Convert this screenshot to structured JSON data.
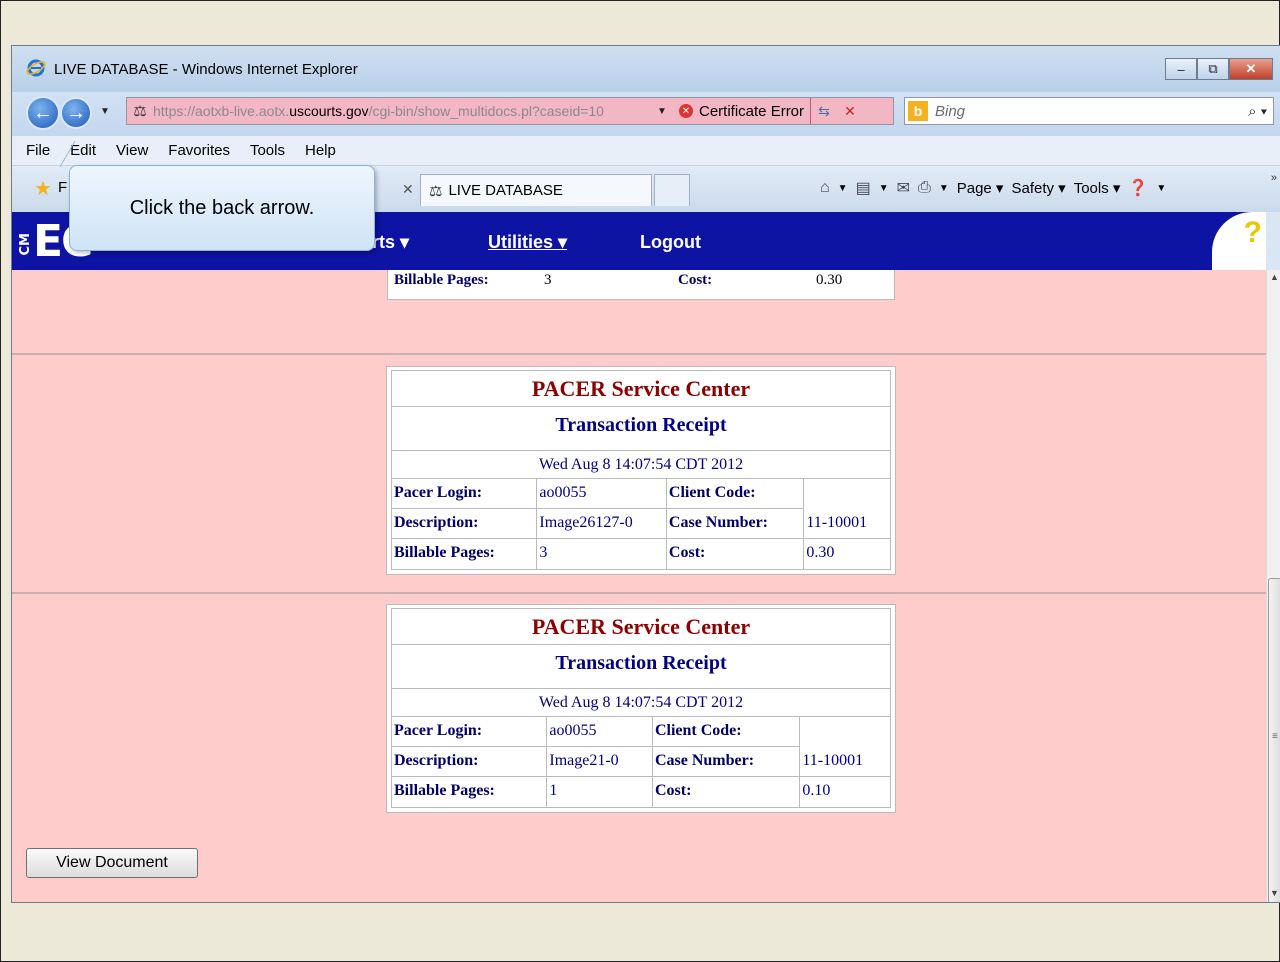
{
  "window": {
    "title": "LIVE DATABASE - Windows Internet Explorer",
    "minimize": "‒",
    "restore": "⧉",
    "close": "✕"
  },
  "address": {
    "url_prefix": "https://aotxb-live.aotx.",
    "url_domain": "uscourts.gov",
    "url_path": "/cgi-bin/show_multidocs.pl?caseid=10",
    "cert_error": "Certificate Error"
  },
  "search": {
    "placeholder": "Bing"
  },
  "menu": [
    "File",
    "Edit",
    "View",
    "Favorites",
    "Tools",
    "Help"
  ],
  "favorites": {
    "letter": "F",
    "tab_title": "LIVE DATABASE",
    "commands": [
      "Page ▾",
      "Safety ▾",
      "Tools ▾"
    ]
  },
  "tooltip": {
    "text": "Click the back arrow."
  },
  "cmecf": {
    "logo_small": "CM",
    "logo": "EC",
    "nav": [
      "rts ▾",
      "Utilities ▾",
      "Logout"
    ],
    "help": "?"
  },
  "partial_receipt": {
    "label1": "Billable Pages:",
    "value1": "3",
    "label2": "Cost:",
    "value2": "0.30"
  },
  "receipts": [
    {
      "title": "PACER Service Center",
      "subtitle": "Transaction Receipt",
      "date": "Wed Aug 8 14:07:54 CDT 2012",
      "rows": [
        {
          "l1": "Pacer Login:",
          "v1": "ao0055",
          "l2": "Client Code:",
          "v2": ""
        },
        {
          "l1": "Description:",
          "v1": "Image26127-0",
          "l2": "Case Number:",
          "v2": "11-10001"
        },
        {
          "l1": "Billable Pages:",
          "v1": "3",
          "l2": "Cost:",
          "v2": "0.30"
        }
      ]
    },
    {
      "title": "PACER Service Center",
      "subtitle": "Transaction Receipt",
      "date": "Wed Aug 8 14:07:54 CDT 2012",
      "rows": [
        {
          "l1": "Pacer Login:",
          "v1": "ao0055",
          "l2": "Client Code:",
          "v2": ""
        },
        {
          "l1": "Description:",
          "v1": "Image21-0",
          "l2": "Case Number:",
          "v2": "11-10001"
        },
        {
          "l1": "Billable Pages:",
          "v1": "1",
          "l2": "Cost:",
          "v2": "0.10"
        }
      ]
    }
  ],
  "buttons": {
    "view_document": "View Document"
  },
  "colors": {
    "page_bg": "#ffcccc",
    "cmecf_bar": "#0d13a3",
    "receipt_title": "#8b0000",
    "receipt_sub": "#000080"
  }
}
